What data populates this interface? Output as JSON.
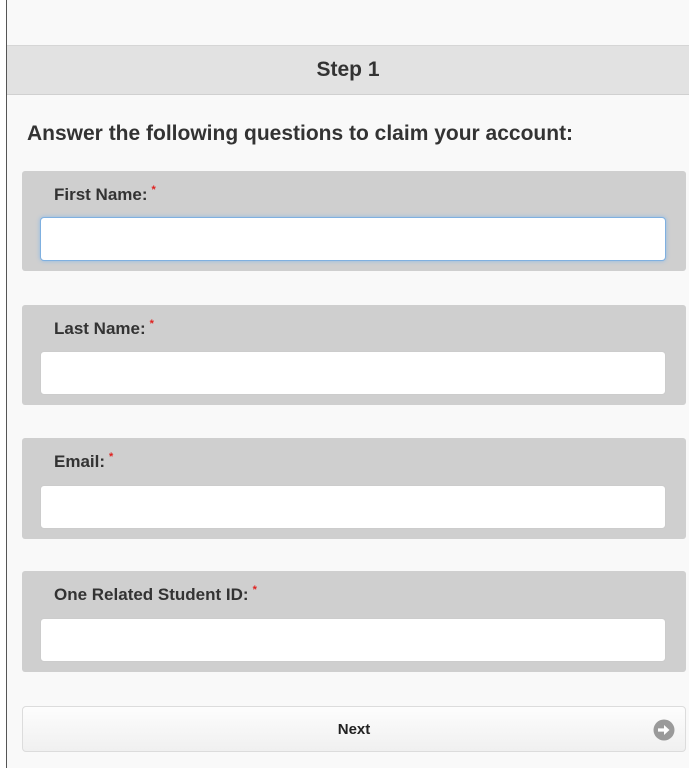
{
  "header": {
    "step_title": "Step 1"
  },
  "form": {
    "instructions": "Answer the following questions to claim your account:",
    "required_marker": "*",
    "fields": [
      {
        "label": "First Name:",
        "value": "",
        "placeholder": ""
      },
      {
        "label": "Last Name:",
        "value": "",
        "placeholder": ""
      },
      {
        "label": "Email:",
        "value": "",
        "placeholder": ""
      },
      {
        "label": "One Related Student ID:",
        "value": "",
        "placeholder": ""
      }
    ],
    "next_label": "Next",
    "next_icon": "arrow-right-circle-icon"
  },
  "colors": {
    "required": "#e0211f",
    "field_background": "#cfcfcf",
    "focus_ring": "#8db9e6"
  }
}
